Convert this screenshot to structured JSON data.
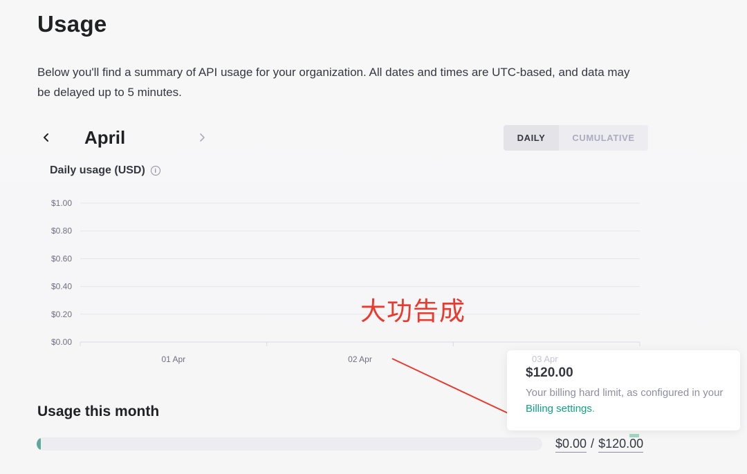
{
  "page": {
    "title": "Usage",
    "description": "Below you'll find a summary of API usage for your organization. All dates and times are UTC-based, and data may be delayed up to 5 minutes."
  },
  "month_nav": {
    "month": "April",
    "prev_icon": "chevron-left-icon",
    "next_icon": "chevron-right-icon"
  },
  "view_toggle": {
    "daily": "DAILY",
    "cumulative": "CUMULATIVE",
    "selected": "DAILY"
  },
  "chart_section": {
    "title": "Daily usage (USD)",
    "info_icon": "info-icon"
  },
  "chart_data": {
    "type": "bar",
    "title": "Daily usage (USD)",
    "categories": [
      "01 Apr",
      "02 Apr",
      "03 Apr"
    ],
    "values": [
      0,
      0,
      0
    ],
    "ylim": [
      0,
      1
    ],
    "yticks": [
      "$1.00",
      "$0.80",
      "$0.60",
      "$0.40",
      "$0.20",
      "$0.00"
    ],
    "grid": true
  },
  "annotation": {
    "text": "大功告成",
    "color": "#e83a2e"
  },
  "usage_this_month": {
    "title": "Usage this month",
    "spent": "$0.00",
    "separator": "/",
    "limit": "$120.00",
    "fraction": 0.0,
    "bar_color": "#5ea89a"
  },
  "tooltip": {
    "hint": "03 Apr",
    "amount": "$120.00",
    "text_before": "Your billing hard limit, as configured in your ",
    "link_text": "Billing settings",
    "text_after": "."
  },
  "colors": {
    "accent": "#10a37f",
    "grid": "#e5e5e9"
  }
}
